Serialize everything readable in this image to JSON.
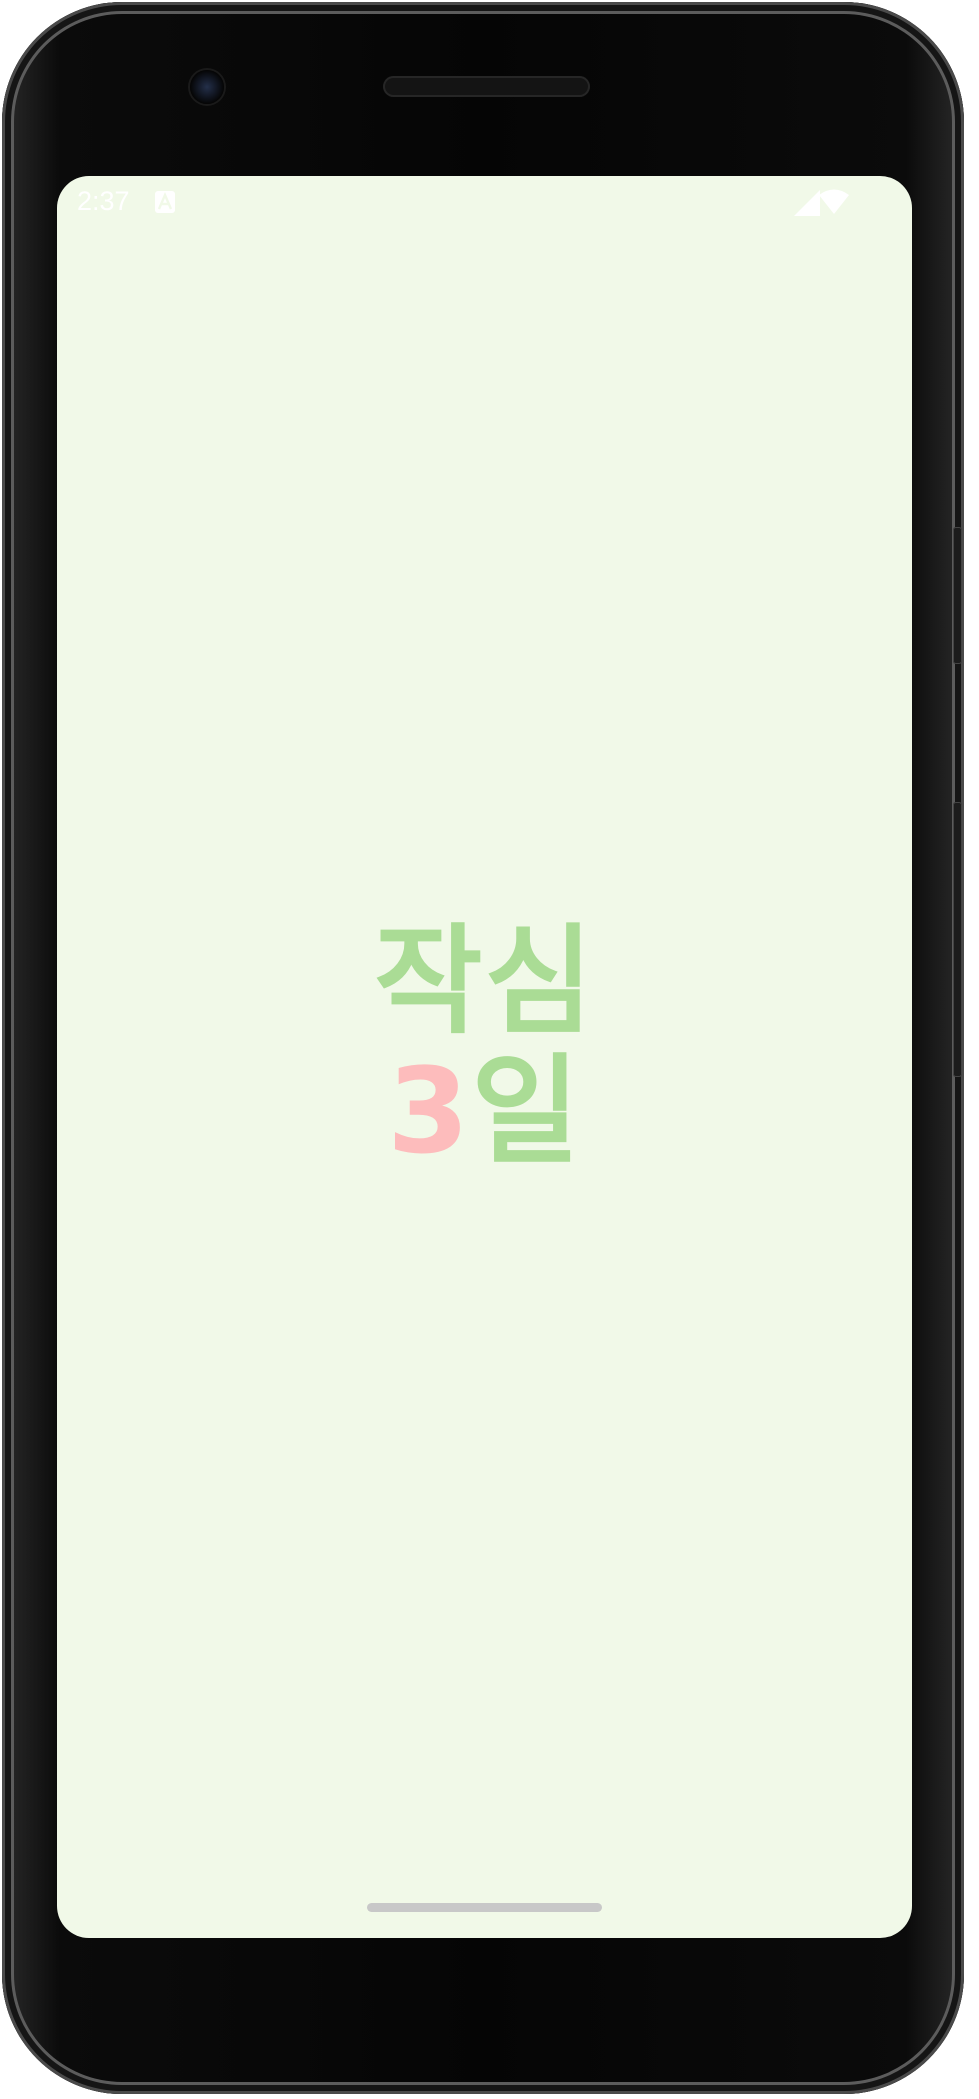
{
  "status_bar": {
    "time": "2:37",
    "icons": [
      "app-notification-icon",
      "wifi-icon",
      "cellular-signal-icon"
    ]
  },
  "splash": {
    "line1": "작심",
    "line2_number": "3",
    "line2_text": "일"
  },
  "colors": {
    "screen_background": "#f1f9e8",
    "logo_green": "#aadc95",
    "logo_pink": "#fdbcbc",
    "status_text": "#ffffff"
  }
}
